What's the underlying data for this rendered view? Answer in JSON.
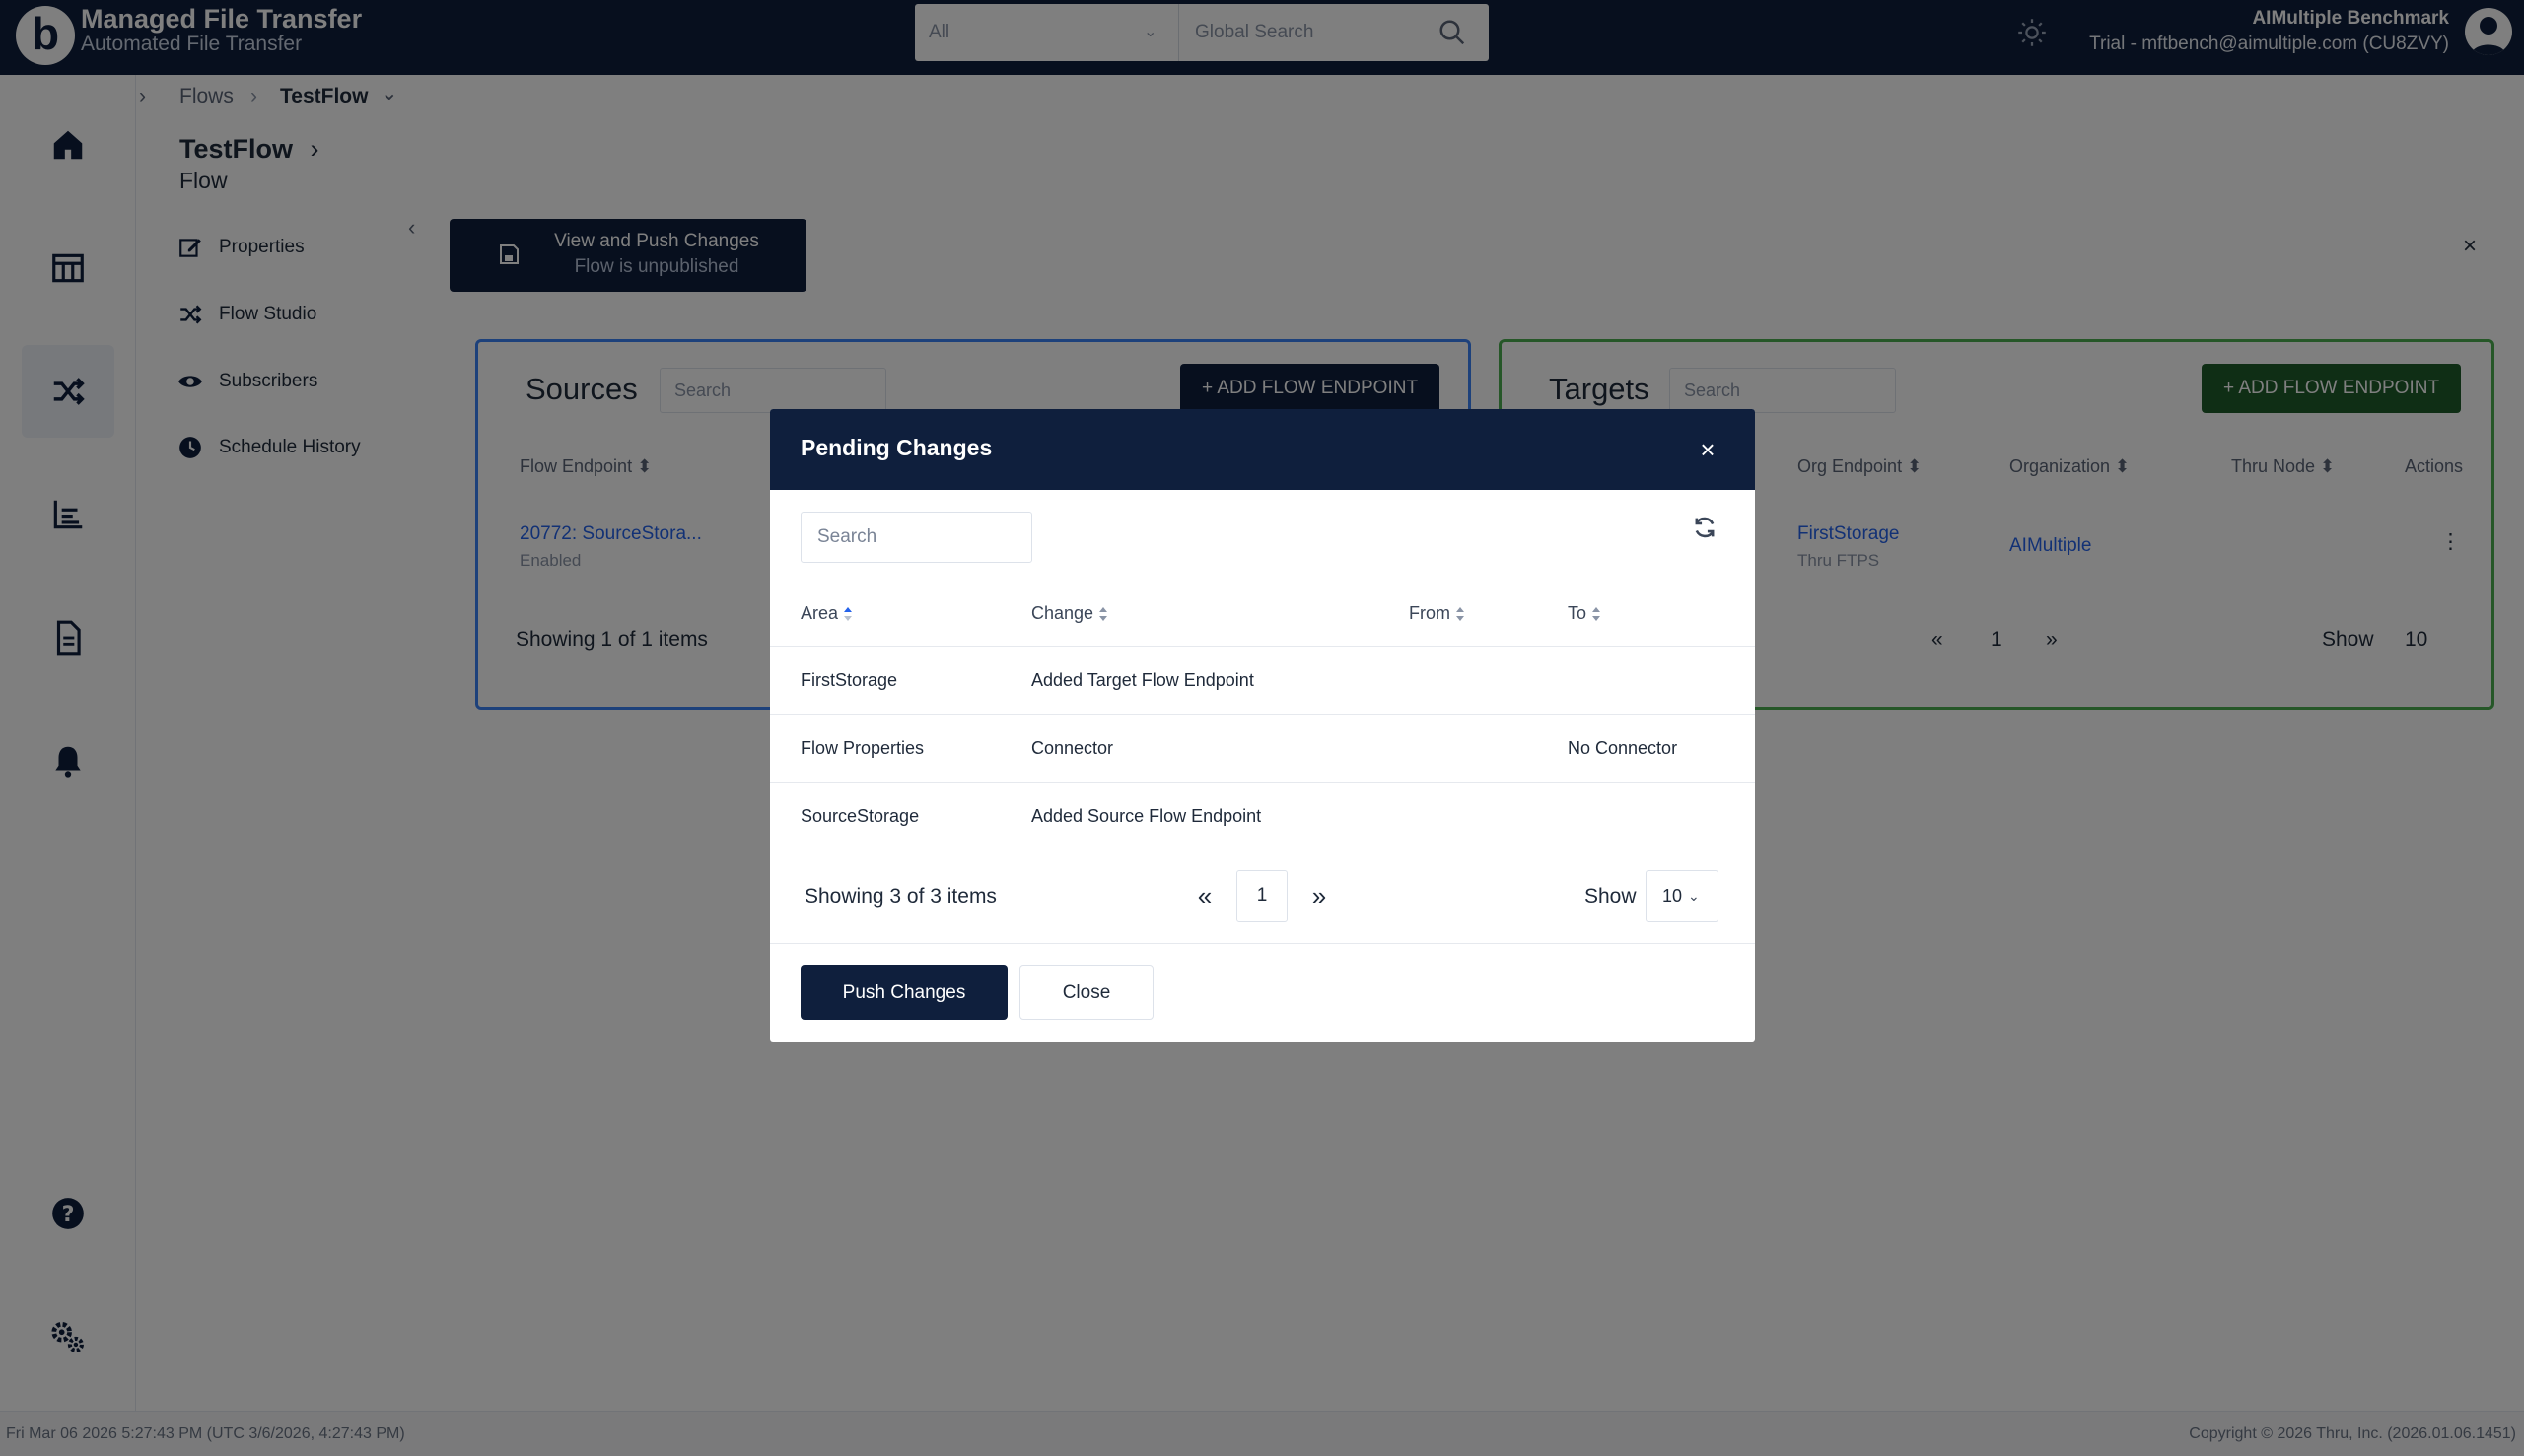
{
  "header": {
    "logo_letter": "b",
    "app_title": "Managed File Transfer",
    "app_subtitle": "Automated File Transfer",
    "search_scope": "All",
    "search_placeholder": "Global Search",
    "user_name": "AIMultiple Benchmark",
    "user_detail": "Trial - mftbench@aimultiple.com (CU8ZVY)"
  },
  "rail": {
    "items": [
      {
        "icon": "home-icon",
        "active": false
      },
      {
        "icon": "dashboard-icon",
        "active": false
      },
      {
        "icon": "shuffle-icon",
        "active": true
      },
      {
        "icon": "chart-icon",
        "active": false
      },
      {
        "icon": "document-icon",
        "active": false
      },
      {
        "icon": "bell-icon",
        "active": false
      },
      {
        "icon": "help-icon",
        "active": false
      },
      {
        "icon": "settings-icon",
        "active": false
      }
    ]
  },
  "breadcrumb": {
    "root": "Flows",
    "sep": "›",
    "current": "TestFlow",
    "chevron": "⌄"
  },
  "flow": {
    "title": "TestFlow",
    "title_chevron": "›",
    "subtitle": "Flow"
  },
  "nav": {
    "items": [
      {
        "label": "Properties",
        "icon": "edit-icon"
      },
      {
        "label": "Flow Studio",
        "icon": "shuffle-icon"
      },
      {
        "label": "Subscribers",
        "icon": "eye-icon"
      },
      {
        "label": "Schedule History",
        "icon": "clock-icon"
      }
    ]
  },
  "push_banner": {
    "line1": "View and Push Changes",
    "line2": "Flow is unpublished"
  },
  "sources": {
    "title": "Sources",
    "search_placeholder": "Search",
    "add_label": "+ ADD FLOW ENDPOINT",
    "col_endpoint": "Flow Endpoint ⬍",
    "row_endpoint": "20772: SourceStora...",
    "row_status": "Enabled",
    "showing": "Showing 1 of 1 items"
  },
  "targets": {
    "title": "Targets",
    "search_placeholder": "Search",
    "add_label": "+ ADD FLOW ENDPOINT",
    "col_org_endpoint": "Org Endpoint ⬍",
    "col_organization": "Organization ⬍",
    "col_thru_node": "Thru Node ⬍",
    "col_actions": "Actions",
    "row_org_endpoint": "FirstStorage",
    "row_thru": "Thru FTPS",
    "row_organization": "AIMultiple",
    "row_actions": "⋮",
    "pager_prev": "«",
    "pager_page": "1",
    "pager_next": "»",
    "show_label": "Show",
    "show_value": "10"
  },
  "modal": {
    "title": "Pending Changes",
    "close": "×",
    "search_placeholder": "Search",
    "columns": [
      "Area",
      "Change",
      "From",
      "To"
    ],
    "rows": [
      {
        "area": "FirstStorage",
        "change": "Added Target Flow Endpoint",
        "from": "",
        "to": ""
      },
      {
        "area": "Flow Properties",
        "change": "Connector",
        "from": "",
        "to": "No Connector"
      },
      {
        "area": "SourceStorage",
        "change": "Added Source Flow Endpoint",
        "from": "",
        "to": ""
      }
    ],
    "showing": "Showing 3 of 3 items",
    "pager_prev": "«",
    "page": "1",
    "pager_next": "»",
    "show_label": "Show",
    "show_value": "10",
    "push_label": "Push Changes",
    "close_label": "Close"
  },
  "page_close": "×",
  "footer": {
    "left": "Fri Mar 06 2026 5:27:43 PM (UTC 3/6/2026, 4:27:43 PM)",
    "right": "Copyright © 2026 Thru, Inc. (2026.01.06.1451)"
  },
  "colors": {
    "navy": "#0f1f3d",
    "sources_border": "#3b82f6",
    "targets_border": "#4caf50",
    "link": "#2563eb"
  }
}
